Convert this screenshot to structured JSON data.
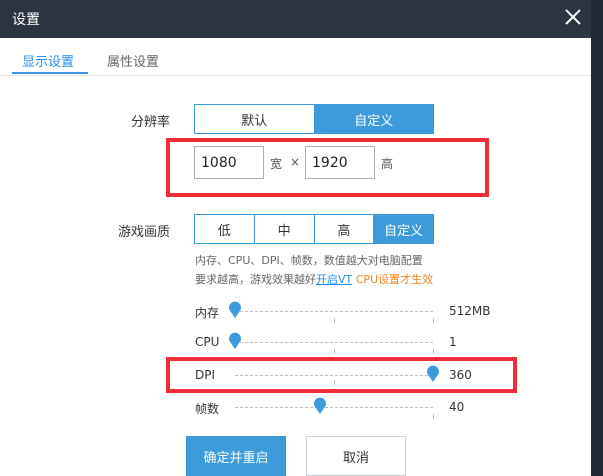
{
  "window": {
    "title": "设置"
  },
  "tabs": [
    {
      "label": "显示设置",
      "active": true
    },
    {
      "label": "属性设置",
      "active": false
    }
  ],
  "resolution": {
    "label": "分辨率",
    "options": [
      "默认",
      "自定义"
    ],
    "selected": "自定义",
    "width": "1080",
    "width_unit": "宽",
    "times": "×",
    "height": "1920",
    "height_unit": "高"
  },
  "quality": {
    "label": "游戏画质",
    "options": [
      "低",
      "中",
      "高",
      "自定义"
    ],
    "selected": "自定义",
    "info_line1": "内存、CPU、DPI、帧数，数值越大对电脑配置",
    "info_line2_prefix": "要求越高，游戏效果越好",
    "info_link": "开启VT",
    "info_suffix": "CPU设置才生效"
  },
  "sliders": [
    {
      "label": "内存",
      "value": "512MB",
      "level": 0.0
    },
    {
      "label": "CPU",
      "value": "1",
      "level": 0.0
    },
    {
      "label": "DPI",
      "value": "360",
      "level": 1.0
    },
    {
      "label": "帧数",
      "value": "40",
      "level": 0.43
    }
  ],
  "buttons": {
    "confirm": "确定并重启",
    "cancel": "取消"
  },
  "colors": {
    "accent": "#3d9bdc",
    "highlight_box": "#ef2b36",
    "titlebar": "#2d3441"
  }
}
